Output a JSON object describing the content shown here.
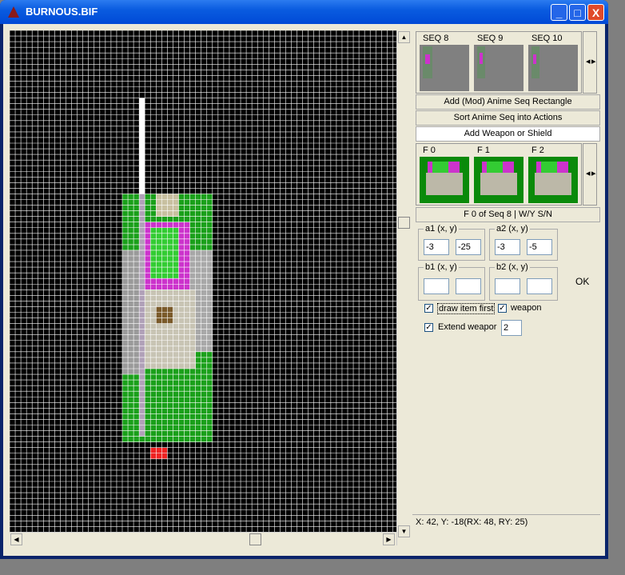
{
  "window": {
    "title": "BURNOUS.BIF"
  },
  "title_buttons": {
    "minimize": "_",
    "maximize": "□",
    "close": "X"
  },
  "sequences": [
    {
      "label": "SEQ 8"
    },
    {
      "label": "SEQ 9"
    },
    {
      "label": "SEQ 10"
    }
  ],
  "frames": [
    {
      "label": "F 0"
    },
    {
      "label": "F 1"
    },
    {
      "label": "F 2"
    }
  ],
  "buttons": {
    "add_rect": "Add (Mod) Anime Seq Rectangle",
    "sort_actions": "Sort  Anime Seq into Actions",
    "add_weapon": "Add Weapon or Shield",
    "frame_info": "F 0 of Seq 8 | W/Y S/N",
    "ok": "OK"
  },
  "groups": {
    "a1": {
      "label": "a1 (x, y)",
      "x": "-3",
      "y": "-25"
    },
    "a2": {
      "label": "a2 (x, y)",
      "x": "-3",
      "y": "-5"
    },
    "b1": {
      "label": "b1 (x, y)",
      "x": "",
      "y": ""
    },
    "b2": {
      "label": "b2 (x, y)",
      "x": "",
      "y": ""
    }
  },
  "checks": {
    "draw_item_first": {
      "label": "draw item first",
      "checked": true
    },
    "weapon": {
      "label": "weapon",
      "checked": true
    },
    "extend_weapon": {
      "label": "Extend weapor",
      "checked": true,
      "value": "2"
    }
  },
  "status": {
    "text": "X: 42, Y: -18(RX: 48, RY: 25)"
  },
  "colors": {
    "grid_bg": "#000000",
    "grid_line": "#ffffff",
    "sprite_green": "#1aa01a",
    "weapon_magenta": "#cc33cc",
    "marker_red": "#ee2222"
  }
}
